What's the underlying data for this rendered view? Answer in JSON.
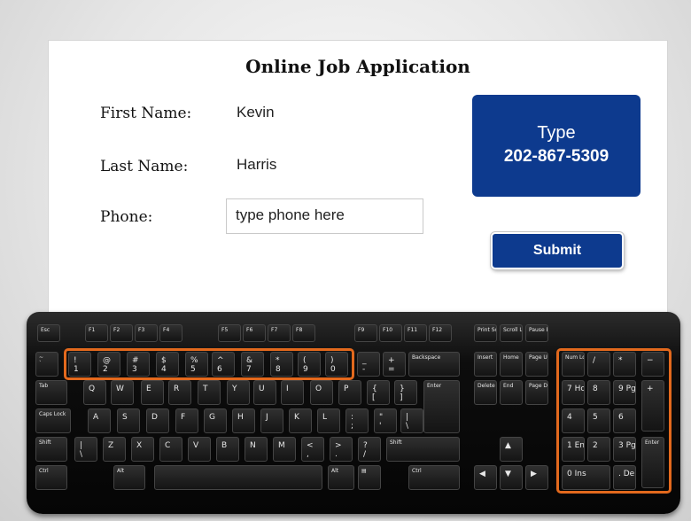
{
  "form": {
    "title": "Online Job Application",
    "first_name_label": "First Name:",
    "first_name_value": "Kevin",
    "last_name_label": "Last Name:",
    "last_name_value": "Harris",
    "phone_label": "Phone:",
    "phone_placeholder": "type phone here",
    "submit_label": "Submit"
  },
  "instruction": {
    "line1": "Type",
    "line2": "202-867-5309"
  },
  "colors": {
    "accent_blue": "#0d3a8e",
    "highlight_orange": "#e3691d"
  },
  "keyboard": {
    "rows": [
      [
        "Esc",
        "F1",
        "F2",
        "F3",
        "F4",
        "F5",
        "F6",
        "F7",
        "F8",
        "F9",
        "F10",
        "F11",
        "F12",
        "Print Screen",
        "Scroll Lock",
        "Pause Break"
      ],
      [
        "~ `",
        "! 1",
        "@ 2",
        "# 3",
        "$ 4",
        "% 5",
        "^ 6",
        "& 7",
        "* 8",
        "( 9",
        ") 0",
        "_ -",
        "+ =",
        "Backspace",
        "Insert",
        "Home",
        "Page Up",
        "Num Lock",
        "/",
        "*",
        "−"
      ],
      [
        "Tab",
        "Q",
        "W",
        "E",
        "R",
        "T",
        "Y",
        "U",
        "I",
        "O",
        "P",
        "{ [",
        "} ]",
        "Enter",
        "Delete",
        "End",
        "Page Down",
        "7 Home",
        "8",
        "9 Pg Up",
        "+"
      ],
      [
        "Caps Lock",
        "A",
        "S",
        "D",
        "F",
        "G",
        "H",
        "J",
        "K",
        "L",
        ": ;",
        "\" '",
        "| \\",
        "4",
        "5",
        "6"
      ],
      [
        "Shift",
        "| \\",
        "Z",
        "X",
        "C",
        "V",
        "B",
        "N",
        "M",
        "< ,",
        "> .",
        "? /",
        "Shift",
        "▲",
        "1 End",
        "2",
        "3 Pg Dn",
        "Enter"
      ],
      [
        "Ctrl",
        "Alt",
        "Alt",
        "▤",
        "Ctrl",
        "◀",
        "▼",
        "▶",
        "0 Ins",
        ". Del"
      ]
    ]
  }
}
